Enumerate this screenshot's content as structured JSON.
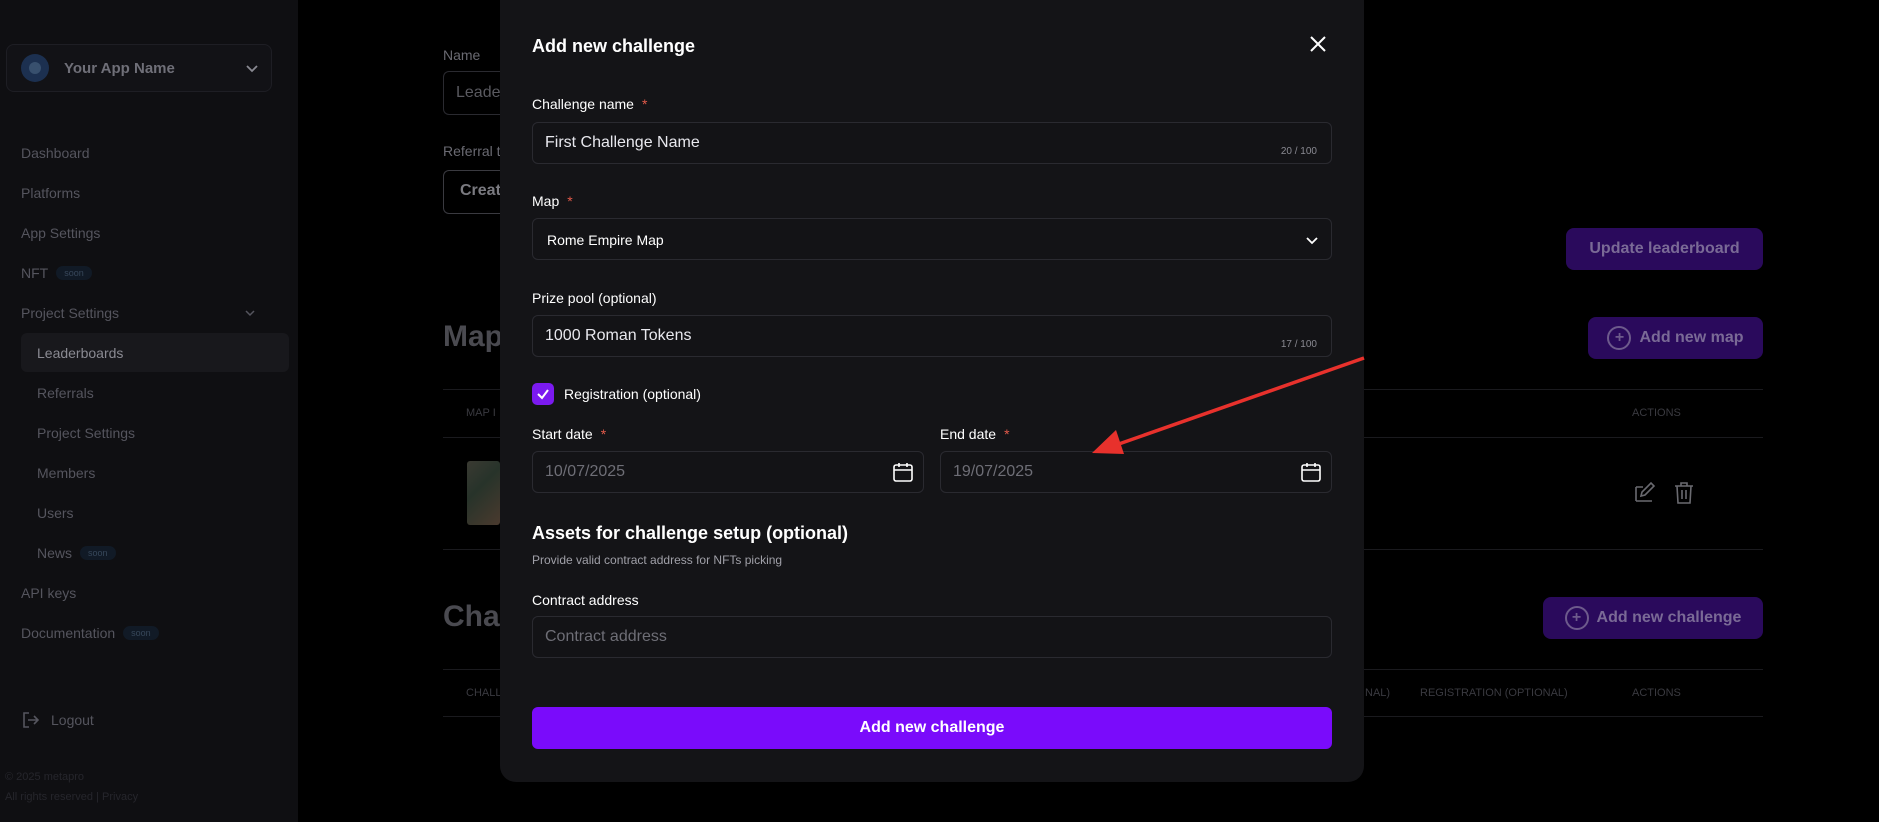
{
  "sidebar": {
    "app_name": "Your App Name",
    "items": [
      {
        "label": "Dashboard"
      },
      {
        "label": "Platforms"
      },
      {
        "label": "App Settings"
      },
      {
        "label": "NFT",
        "badge": "soon"
      },
      {
        "label": "Project Settings"
      },
      {
        "label": "Leaderboards"
      },
      {
        "label": "Referrals"
      },
      {
        "label": "Project Settings"
      },
      {
        "label": "Members"
      },
      {
        "label": "Users"
      },
      {
        "label": "News",
        "badge": "soon"
      },
      {
        "label": "API keys"
      },
      {
        "label": "Documentation",
        "badge": "soon"
      }
    ],
    "logout": "Logout",
    "copyright": "© 2025 metapro",
    "rights": "All rights reserved | Privacy"
  },
  "background": {
    "name_label": "Name",
    "name_value": "Leade",
    "referral_label": "Referral t",
    "referral_btn": "Creat",
    "update_btn": "Update leaderboard",
    "maps_heading": "Map",
    "add_map_btn": "Add new map",
    "maps_col_left": "MAP I",
    "maps_col_actions": "ACTIONS",
    "challenges_heading": "Chal",
    "add_challenge_btn": "Add new challenge",
    "ch_col_left": "CHALL",
    "ch_col_optional": "NAL)",
    "ch_col_registration": "REGISTRATION (OPTIONAL)",
    "ch_col_actions": "ACTIONS"
  },
  "modal": {
    "title": "Add new challenge",
    "challenge_name": {
      "label": "Challenge name",
      "required": "*",
      "value": "First Challenge Name",
      "count": "20 / 100"
    },
    "map": {
      "label": "Map",
      "required": "*",
      "value": "Rome Empire Map"
    },
    "prize_pool": {
      "label": "Prize pool (optional)",
      "value": "1000 Roman Tokens",
      "count": "17 / 100"
    },
    "registration": {
      "label": "Registration (optional)",
      "checked": true
    },
    "start_date": {
      "label": "Start date",
      "required": "*",
      "placeholder": "10/07/2025"
    },
    "end_date": {
      "label": "End date",
      "required": "*",
      "placeholder": "19/07/2025"
    },
    "assets_heading": "Assets for challenge setup (optional)",
    "assets_sub": "Provide valid contract address for NFTs picking",
    "contract": {
      "label": "Contract address",
      "placeholder": "Contract address"
    },
    "submit": "Add new challenge"
  },
  "colors": {
    "accent": "#7a0bfb",
    "annotation_arrow": "#e8312c"
  }
}
